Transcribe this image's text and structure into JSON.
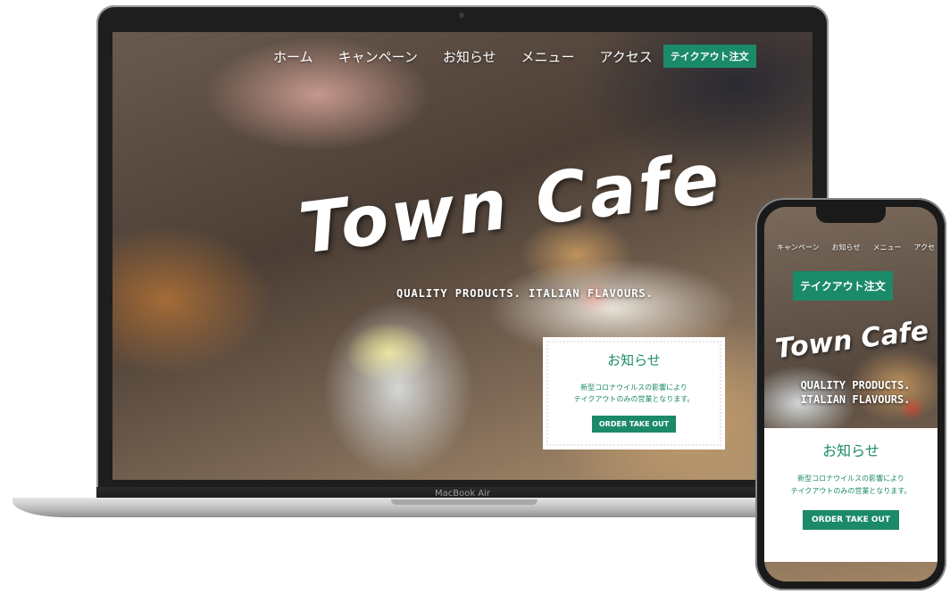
{
  "colors": {
    "accent": "#1b8a69",
    "laptop_frame": "#1e1e1e",
    "base": "#b9b9b9"
  },
  "laptop": {
    "brand_label": "MacBook Air",
    "nav": {
      "items": [
        {
          "label": "ホーム"
        },
        {
          "label": "キャンペーン"
        },
        {
          "label": "お知らせ"
        },
        {
          "label": "メニュー"
        },
        {
          "label": "アクセス"
        }
      ],
      "cta_label": "テイクアウト注文"
    },
    "hero": {
      "title": "Town Cafe",
      "tagline": "QUALITY PRODUCTS. ITALIAN FLAVOURS."
    },
    "notice": {
      "title": "お知らせ",
      "body_line1": "新型コロナウイルスの影響により",
      "body_line2": "テイクアウトのみの営業となります。",
      "button_label": "ORDER TAKE OUT"
    }
  },
  "phone": {
    "nav": {
      "items": [
        {
          "label": "キャンペーン"
        },
        {
          "label": "お知らせ"
        },
        {
          "label": "メニュー"
        },
        {
          "label": "アクセ"
        }
      ],
      "cta_label": "テイクアウト注文"
    },
    "hero": {
      "title": "Town Cafe",
      "tagline_line1": "QUALITY PRODUCTS.",
      "tagline_line2": "ITALIAN FLAVOURS."
    },
    "notice": {
      "title": "お知らせ",
      "body_line1": "新型コロナウイルスの影響により",
      "body_line2": "テイクアウトのみの営業となります。",
      "button_label": "ORDER TAKE OUT"
    }
  }
}
